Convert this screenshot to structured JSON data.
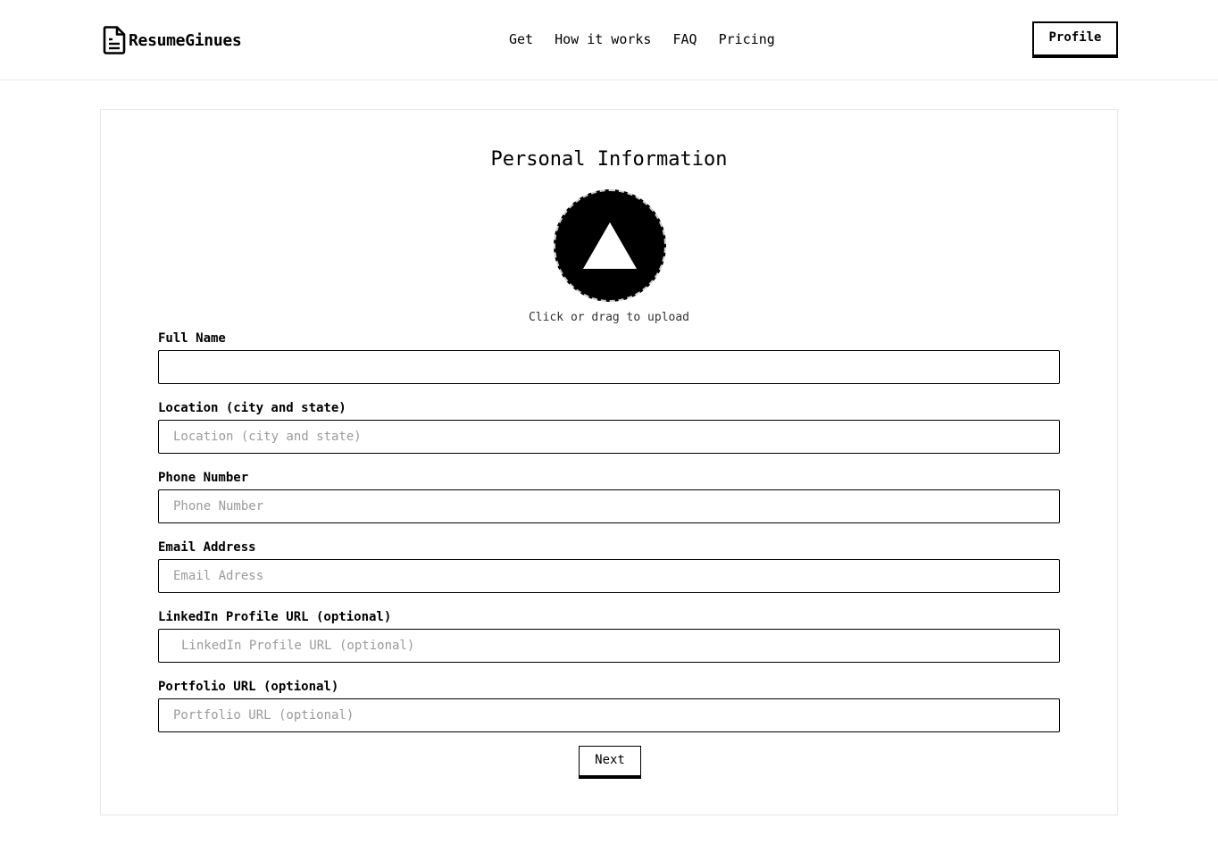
{
  "header": {
    "brand_name": "ResumeGinues",
    "brand_icon": "document-icon",
    "nav": [
      "Get",
      "How it works",
      "FAQ",
      "Pricing"
    ],
    "profile_label": "Profile"
  },
  "form": {
    "title": "Personal Information",
    "upload_icon": "triangle-up-icon",
    "upload_caption": "Click or drag to upload",
    "fields": [
      {
        "label": "Full Name",
        "placeholder": "",
        "value": ""
      },
      {
        "label": "Location (city and state)",
        "placeholder": "Location (city and state)",
        "value": ""
      },
      {
        "label": "Phone Number",
        "placeholder": "Phone Number",
        "value": ""
      },
      {
        "label": "Email Address",
        "placeholder": "Email Adress",
        "value": ""
      },
      {
        "label": "LinkedIn Profile URL (optional)",
        "placeholder": "LinkedIn Profile URL (optional)",
        "value": ""
      },
      {
        "label": "Portfolio URL (optional)",
        "placeholder": "Portfolio URL (optional)",
        "value": ""
      }
    ],
    "next_label": "Next"
  },
  "colors": {
    "background": "#ffffff",
    "text": "#000000",
    "placeholder": "#9b9b9b",
    "border": "#000000",
    "divider": "#e8e8e8"
  }
}
